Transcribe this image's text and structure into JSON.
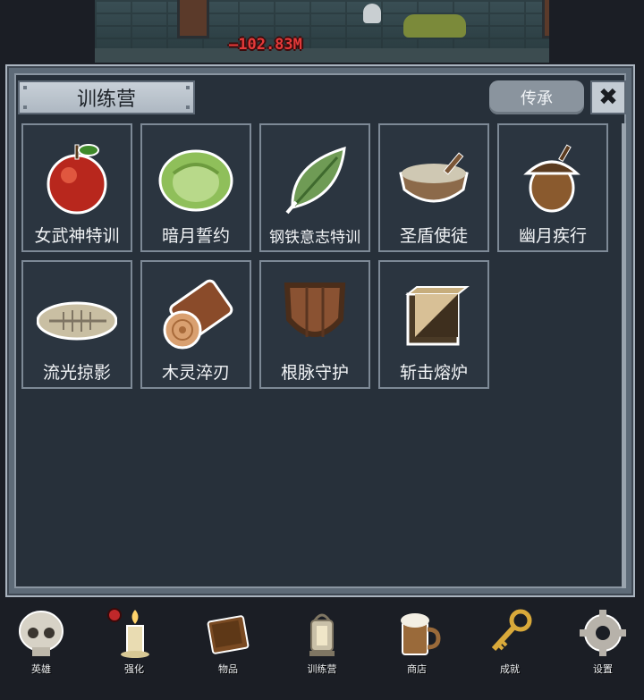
{
  "scene": {
    "damage_text": "—102.83M"
  },
  "panel": {
    "title": "训练营",
    "legacy_label": "传承",
    "close_glyph": "✖"
  },
  "cards": [
    {
      "label": "女武神特训",
      "icon": "apple-icon"
    },
    {
      "label": "暗月誓约",
      "icon": "cabbage-icon"
    },
    {
      "label": "钢铁意志特训",
      "icon": "leaf-icon"
    },
    {
      "label": "圣盾使徒",
      "icon": "porridge-bowl-icon"
    },
    {
      "label": "幽月疾行",
      "icon": "acorn-icon"
    },
    {
      "label": "流光掠影",
      "icon": "fish-bone-icon"
    },
    {
      "label": "木灵淬刃",
      "icon": "log-icon"
    },
    {
      "label": "根脉守护",
      "icon": "wooden-shield-icon"
    },
    {
      "label": "斩击熔炉",
      "icon": "crate-icon"
    }
  ],
  "nav": [
    {
      "label": "英雄",
      "icon": "skull-icon"
    },
    {
      "label": "强化",
      "icon": "candle-icon"
    },
    {
      "label": "物品",
      "icon": "book-icon"
    },
    {
      "label": "训练营",
      "icon": "lantern-icon"
    },
    {
      "label": "商店",
      "icon": "beer-mug-icon"
    },
    {
      "label": "成就",
      "icon": "key-icon"
    },
    {
      "label": "设置",
      "icon": "gear-icon"
    }
  ],
  "colors": {
    "panel_bg": "#27303a",
    "card_border": "#7d8996",
    "notification_dot": "#c0282a"
  }
}
